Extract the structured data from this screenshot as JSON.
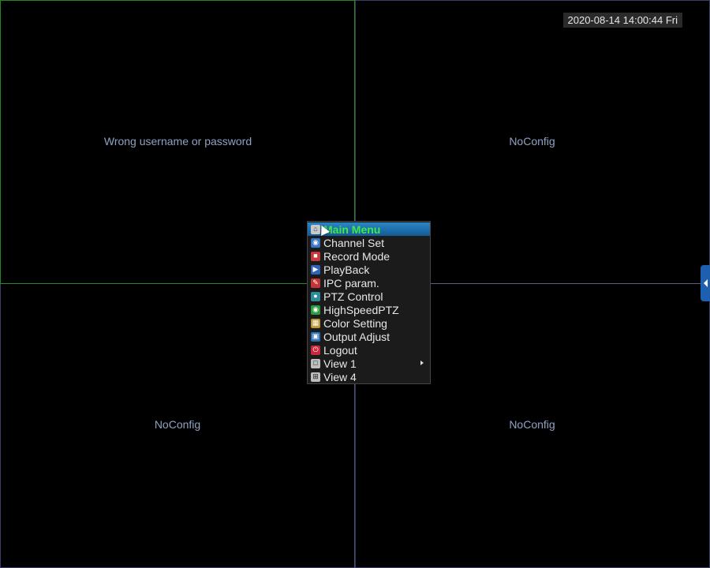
{
  "datetime": "2020-08-14 14:00:44 Fri",
  "channels": [
    {
      "message": "Wrong username or password"
    },
    {
      "message": "NoConfig"
    },
    {
      "message": "NoConfig"
    },
    {
      "message": "NoConfig"
    }
  ],
  "context_menu": {
    "items": [
      {
        "label": "Main Menu",
        "icon": "home-icon",
        "active": true
      },
      {
        "label": "Channel Set",
        "icon": "camera-icon"
      },
      {
        "label": "Record Mode",
        "icon": "record-icon"
      },
      {
        "label": "PlayBack",
        "icon": "playback-icon"
      },
      {
        "label": "IPC param.",
        "icon": "ipc-param-icon"
      },
      {
        "label": "PTZ Control",
        "icon": "ptz-icon"
      },
      {
        "label": "HighSpeedPTZ",
        "icon": "highspeed-ptz-icon"
      },
      {
        "label": "Color Setting",
        "icon": "color-grid-icon"
      },
      {
        "label": "Output Adjust",
        "icon": "monitor-icon"
      },
      {
        "label": "Logout",
        "icon": "power-icon"
      },
      {
        "label": "View 1",
        "icon": "single-view-icon",
        "has_submenu": true
      },
      {
        "label": "View 4",
        "icon": "quad-view-icon"
      }
    ]
  },
  "colors": {
    "active_tile_border": "#1f8a1f",
    "menu_highlight": "#2a86c4",
    "menu_active_text": "#41e84a",
    "side_tab": "#1f5fb0"
  }
}
